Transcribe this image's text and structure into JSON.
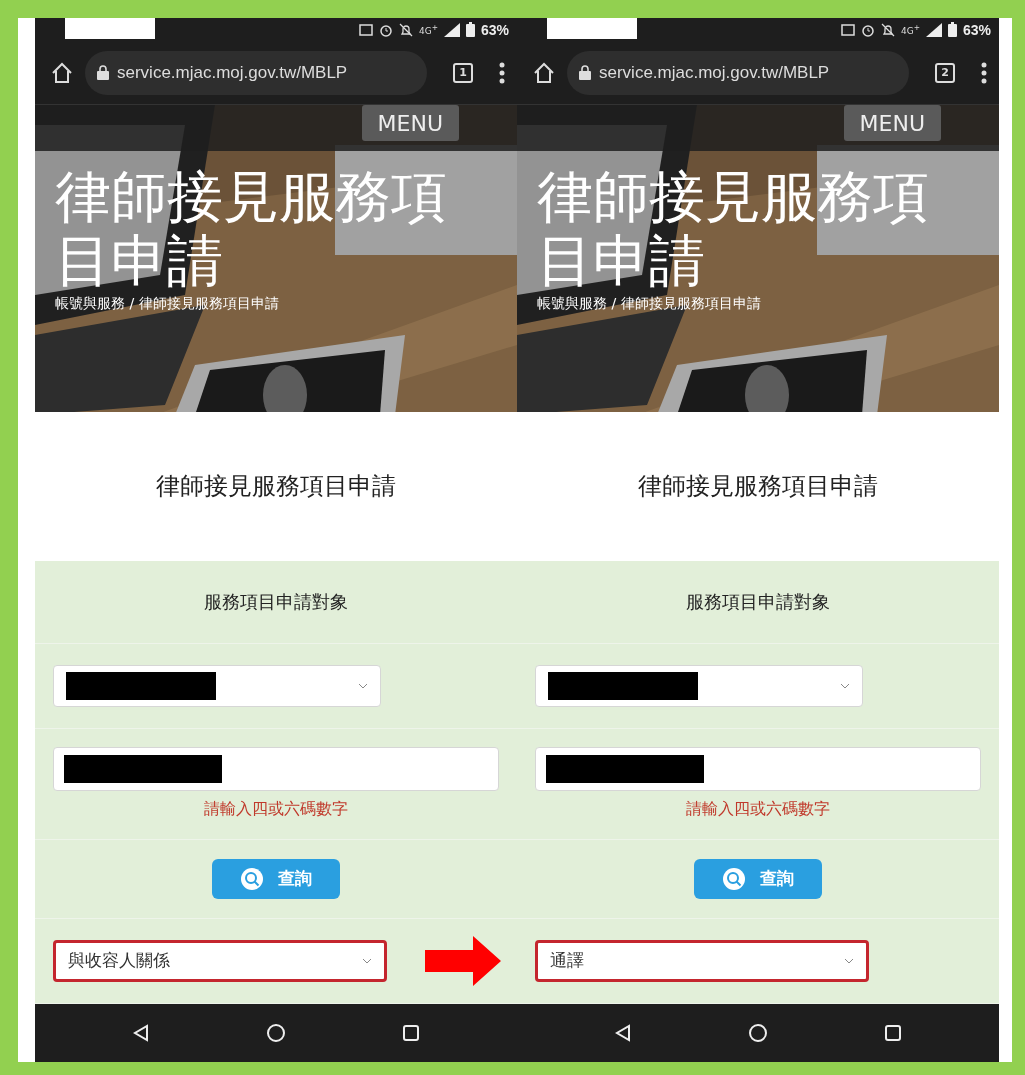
{
  "phones": [
    {
      "status_bar": {
        "network": "4G$^{+}$",
        "battery": "63%"
      },
      "browser": {
        "url": "service.mjac.moj.gov.tw/MBLP",
        "tab_count": "1"
      },
      "menu_button": "MENU",
      "hero": {
        "title": "律師接見服務項目申請",
        "breadcrumb": "帳號與服務 / 律師接見服務項目申請"
      },
      "page_title": "律師接見服務項目申請",
      "form": {
        "section_title": "服務項目申請對象",
        "hint": "請輸入四或六碼數字",
        "search_button": "查詢",
        "relation_select": {
          "value": "與收容人關係",
          "highlighted": true
        }
      }
    },
    {
      "status_bar": {
        "network": "4G$^{+}$",
        "battery": "63%"
      },
      "browser": {
        "url": "service.mjac.moj.gov.tw/MBLP",
        "tab_count": "2"
      },
      "menu_button": "MENU",
      "hero": {
        "title": "律師接見服務項目申請",
        "breadcrumb": "帳號與服務 / 律師接見服務項目申請"
      },
      "page_title": "律師接見服務項目申請",
      "form": {
        "section_title": "服務項目申請對象",
        "hint": "請輸入四或六碼數字",
        "search_button": "查詢",
        "relation_select": {
          "value": "通譯",
          "highlighted": true
        }
      }
    }
  ]
}
